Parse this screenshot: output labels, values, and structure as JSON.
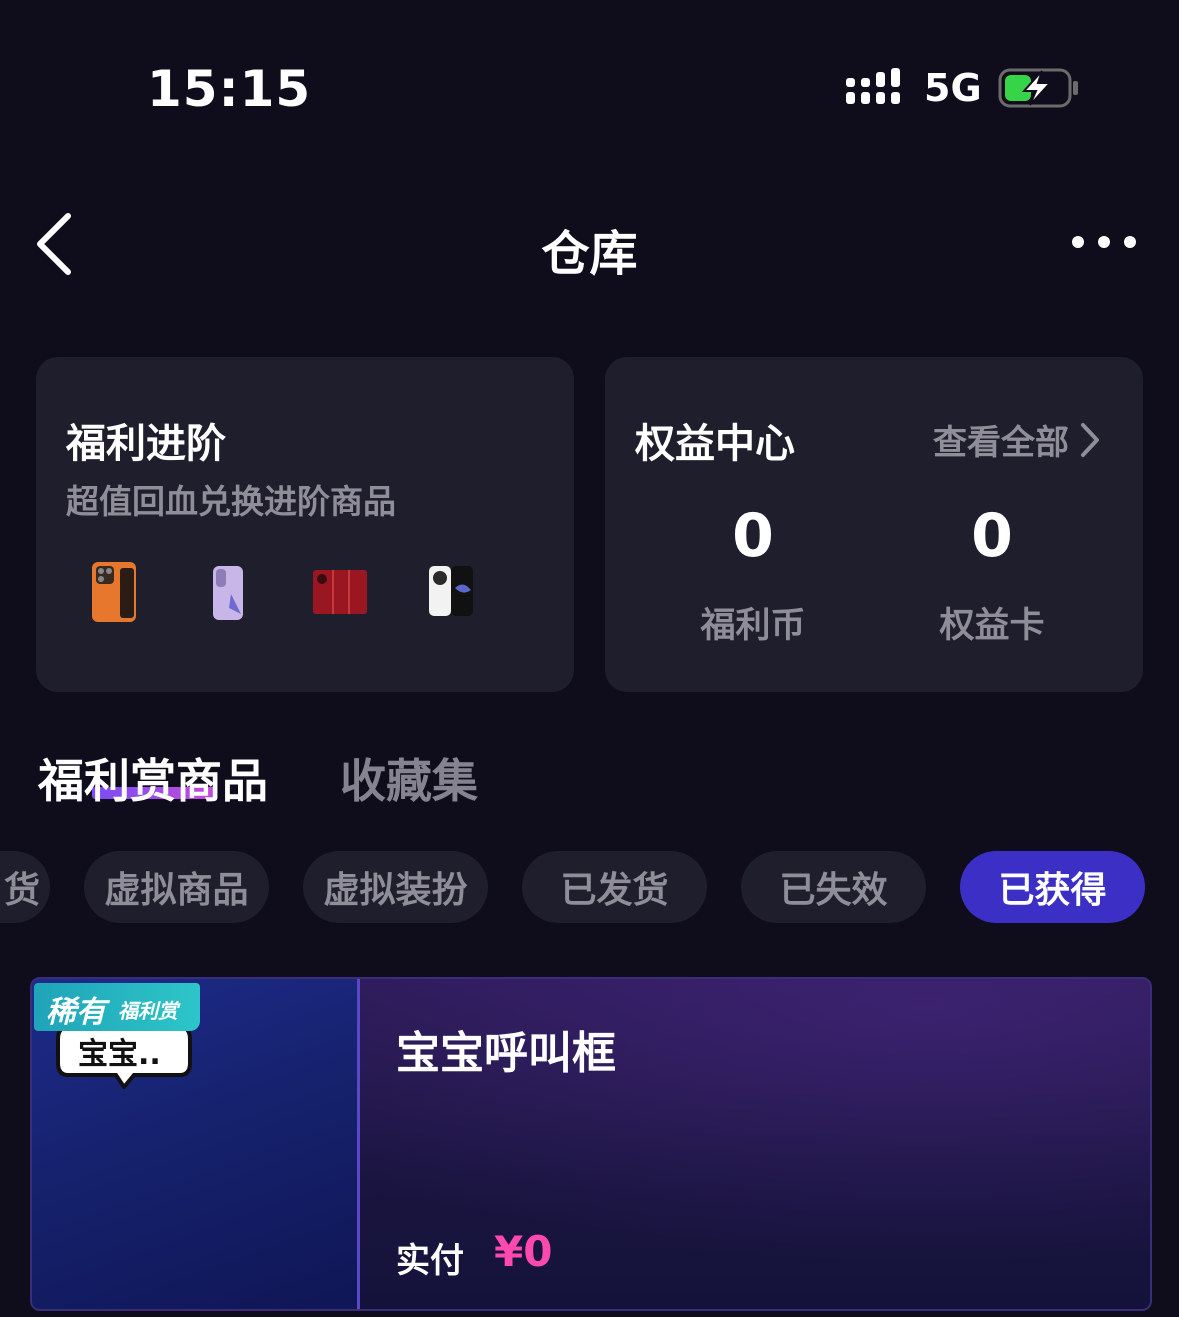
{
  "status_bar": {
    "time": "15:15",
    "network": "5G"
  },
  "nav": {
    "title": "仓库"
  },
  "benefit_card": {
    "title": "福利进阶",
    "subtitle": "超值回血兑换进阶商品",
    "products": [
      "orange-phone-icon",
      "purple-phone-icon",
      "red-fold-phone-icon",
      "white-phone-icon"
    ]
  },
  "rights_card": {
    "title": "权益中心",
    "view_all": "查看全部",
    "stats": [
      {
        "value": "0",
        "label": "福利币"
      },
      {
        "value": "0",
        "label": "权益卡"
      }
    ]
  },
  "tabs": [
    {
      "label": "福利赏商品",
      "active": true
    },
    {
      "label": "收藏集",
      "active": false
    }
  ],
  "filters": [
    {
      "label": "货",
      "active": false
    },
    {
      "label": "虚拟商品",
      "active": false
    },
    {
      "label": "虚拟装扮",
      "active": false
    },
    {
      "label": "已发货",
      "active": false
    },
    {
      "label": "已失效",
      "active": false
    },
    {
      "label": "已获得",
      "active": true
    }
  ],
  "product": {
    "badge_main": "稀有",
    "badge_sub": "福利赏",
    "thumb_text": "宝宝..",
    "name": "宝宝呼叫框",
    "paid_label": "实付",
    "price": "¥0"
  },
  "colors": {
    "accent": "#3b2fc6",
    "price": "#ff49b0",
    "background": "#0f0d1c",
    "card": "#1e1e2d"
  }
}
